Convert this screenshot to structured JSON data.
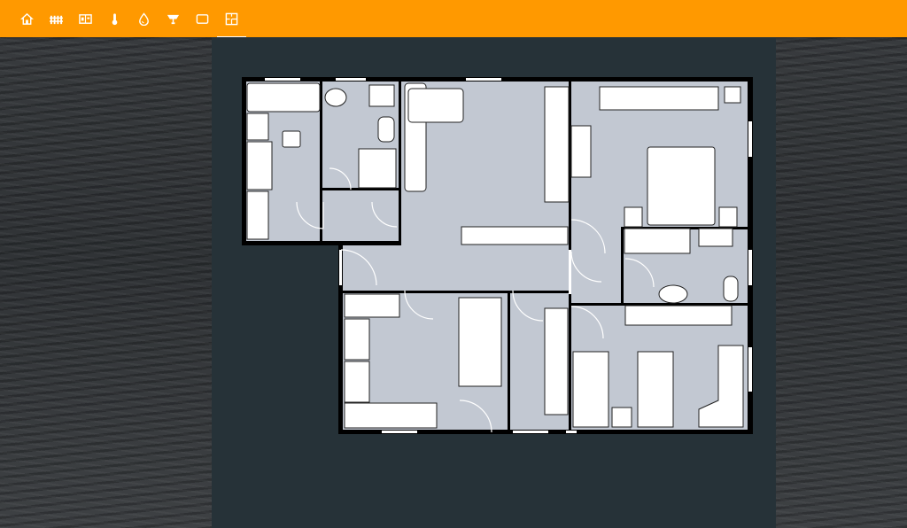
{
  "toolbar": {
    "accent_color": "#ff9900",
    "tabs": [
      {
        "icon": "home-icon"
      },
      {
        "icon": "fence-icon"
      },
      {
        "icon": "panel-icon"
      },
      {
        "icon": "thermometer-icon"
      },
      {
        "icon": "water-drop-icon"
      },
      {
        "icon": "lamp-icon"
      },
      {
        "icon": "rectangle-icon"
      },
      {
        "icon": "floorplan-icon"
      }
    ],
    "active_tab": 7
  },
  "view": {
    "panel_color": "#263238",
    "floor_color": "#c2c8d2",
    "wall_color": "#000000"
  }
}
